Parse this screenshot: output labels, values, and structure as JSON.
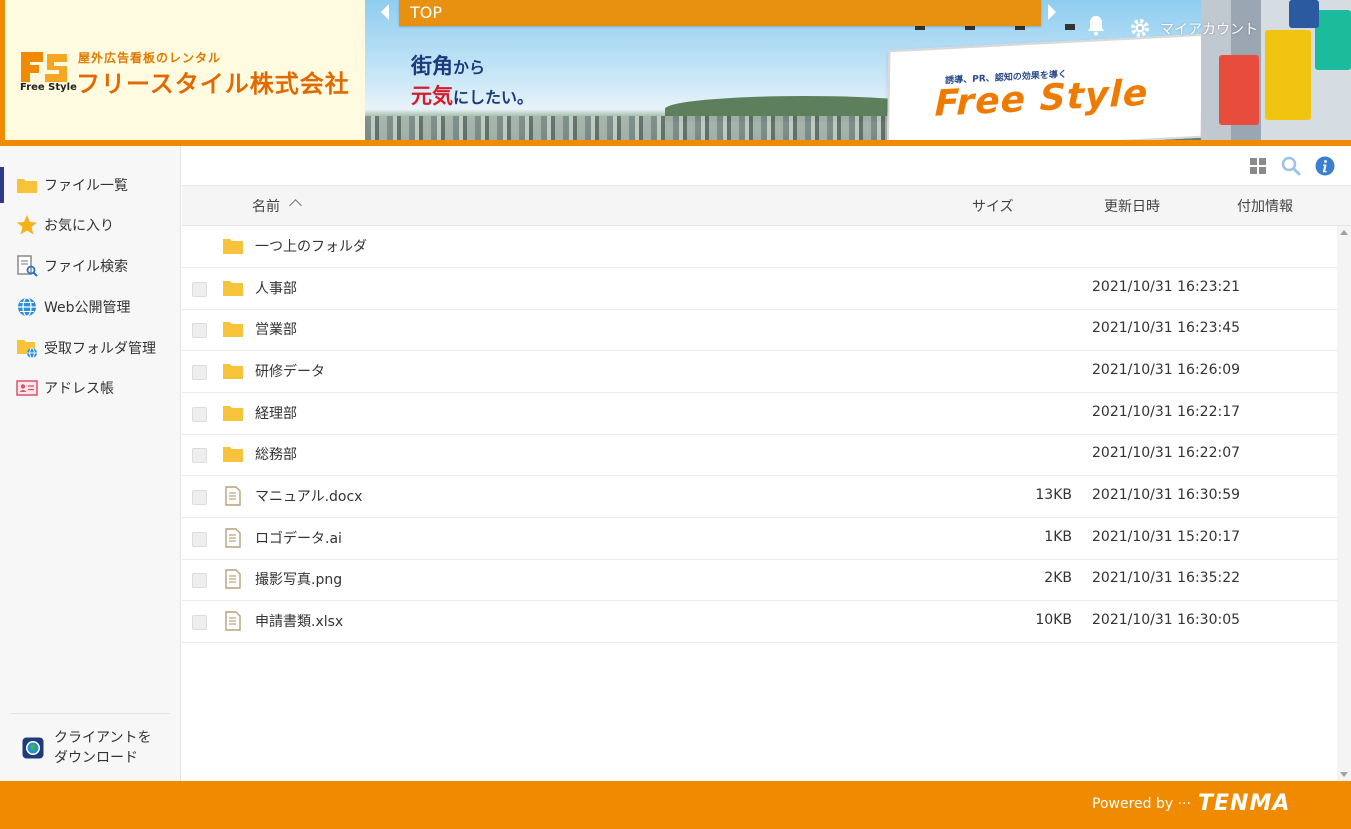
{
  "header": {
    "logo": {
      "mark_text": "Free Style",
      "tagline": "屋外広告看板のレンタル",
      "company": "フリースタイル株式会社"
    },
    "banner": {
      "slogan_line1_main": "街角",
      "slogan_line1_tail": "から",
      "slogan_line2_main": "元気",
      "slogan_line2_tail": "にしたい。",
      "billboard_sub": "誘導、PR、認知の効果を導く",
      "billboard_brand": "Free Style"
    },
    "nav_bar": {
      "title": "TOP"
    },
    "my_account_label": "マイアカウント"
  },
  "sidebar": {
    "items": [
      {
        "label": "ファイル一覧",
        "icon": "folder-icon"
      },
      {
        "label": "お気に入り",
        "icon": "star-icon"
      },
      {
        "label": "ファイル検索",
        "icon": "file-search-icon"
      },
      {
        "label": "Web公開管理",
        "icon": "globe-icon"
      },
      {
        "label": "受取フォルダ管理",
        "icon": "receive-folder-icon"
      },
      {
        "label": "アドレス帳",
        "icon": "address-book-icon"
      }
    ],
    "client_download": "クライアントを\nダウンロード"
  },
  "toolbar": {
    "icons": [
      "grid-view-icon",
      "search-icon",
      "info-icon"
    ]
  },
  "table": {
    "columns": {
      "name": "名前",
      "size": "サイズ",
      "updated": "更新日時",
      "extra": "付加情報"
    },
    "parent_folder": "一つ上のフォルダ",
    "rows": [
      {
        "type": "folder",
        "name": "人事部",
        "size": "",
        "updated": "2021/10/31 16:23:21"
      },
      {
        "type": "folder",
        "name": "営業部",
        "size": "",
        "updated": "2021/10/31 16:23:45"
      },
      {
        "type": "folder",
        "name": "研修データ",
        "size": "",
        "updated": "2021/10/31 16:26:09"
      },
      {
        "type": "folder",
        "name": "経理部",
        "size": "",
        "updated": "2021/10/31 16:22:17"
      },
      {
        "type": "folder",
        "name": "総務部",
        "size": "",
        "updated": "2021/10/31 16:22:07"
      },
      {
        "type": "file",
        "name": "マニュアル.docx",
        "size": "13KB",
        "updated": "2021/10/31 16:30:59"
      },
      {
        "type": "file",
        "name": "ロゴデータ.ai",
        "size": "1KB",
        "updated": "2021/10/31 15:20:17"
      },
      {
        "type": "file",
        "name": "撮影写真.png",
        "size": "2KB",
        "updated": "2021/10/31 16:35:22"
      },
      {
        "type": "file",
        "name": "申請書類.xlsx",
        "size": "10KB",
        "updated": "2021/10/31 16:30:05"
      }
    ]
  },
  "footer": {
    "powered_by": "Powered by ···",
    "brand": "TENMA"
  },
  "colors": {
    "accent_orange": "#f08a00",
    "nav_active": "#303a8a",
    "folder_yellow": "#f7c33a"
  }
}
